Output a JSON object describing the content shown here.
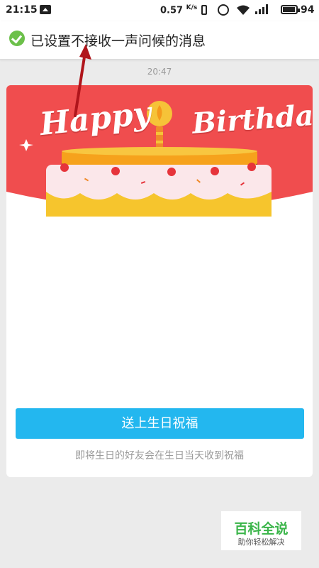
{
  "status_bar": {
    "time": "21:15",
    "network_speed": "0.57",
    "network_speed_unit": "K/s",
    "battery_percent": "94",
    "icons": [
      "message-icon",
      "vibrate-icon",
      "alarm-icon",
      "wifi-icon",
      "signal-icon",
      "battery-icon"
    ]
  },
  "toast": {
    "icon": "check-circle-icon",
    "text": "已设置不接收一声问候的消息",
    "icon_color": "#6cc04a"
  },
  "chat": {
    "timestamp": "20:47"
  },
  "birthday_card": {
    "banner_words": {
      "happy": "Happy",
      "birthday": "Birthday"
    },
    "banner_color": "#f04d4e",
    "button_label": "送上生日祝福",
    "button_color": "#23b7ef",
    "hint": "即将生日的好友会在生日当天收到祝福"
  },
  "watermark": {
    "title": "百科全说",
    "subtitle": "助你轻松解决"
  },
  "annotation": {
    "arrow_color": "#b0151b"
  }
}
